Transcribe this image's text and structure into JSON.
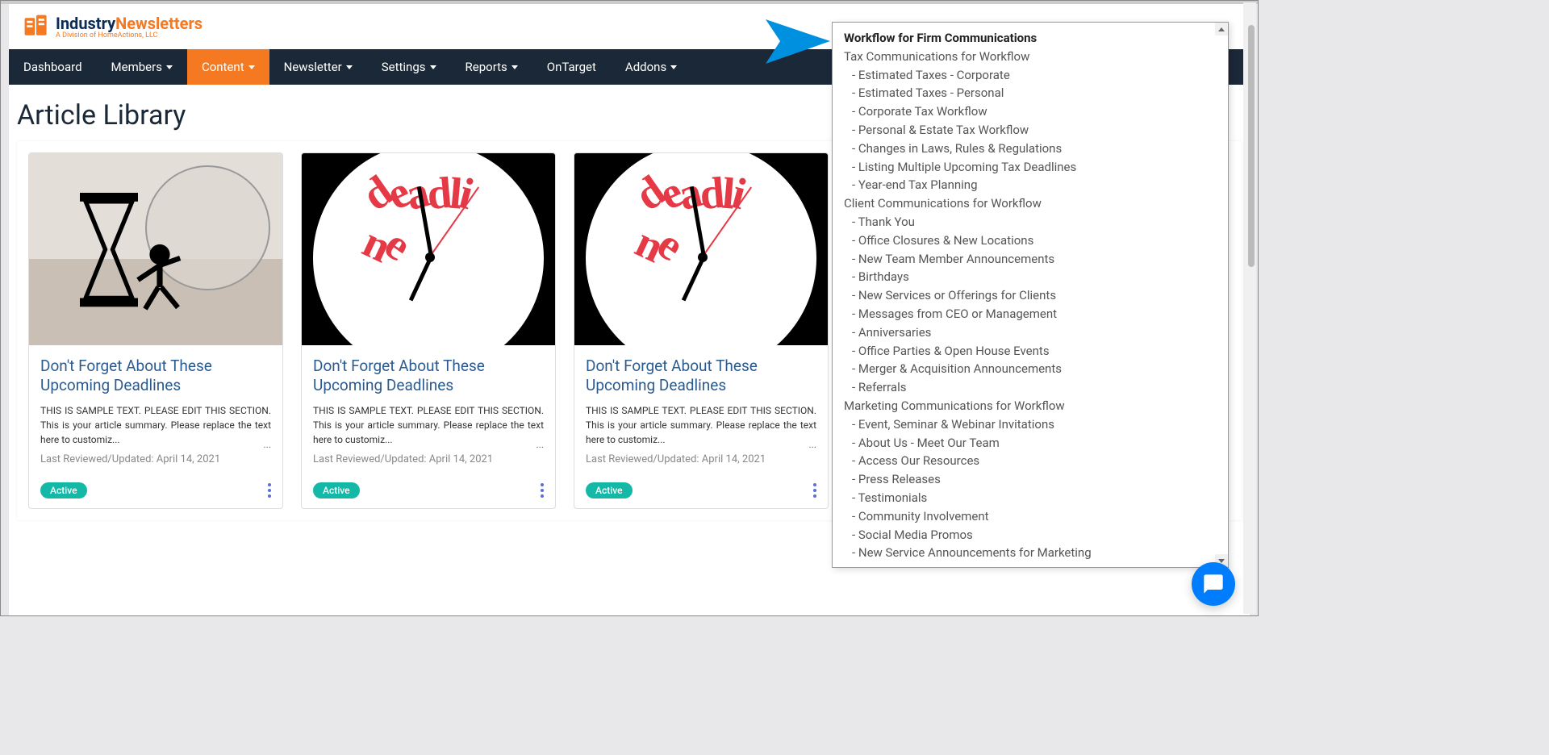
{
  "logo": {
    "brand1": "Industry",
    "brand2": "Newsletters",
    "subtitle": "A Division of HomeActions, LLC"
  },
  "nav": [
    {
      "label": "Dashboard",
      "dropdown": false,
      "active": false
    },
    {
      "label": "Members",
      "dropdown": true,
      "active": false
    },
    {
      "label": "Content",
      "dropdown": true,
      "active": true
    },
    {
      "label": "Newsletter",
      "dropdown": true,
      "active": false
    },
    {
      "label": "Settings",
      "dropdown": true,
      "active": false
    },
    {
      "label": "Reports",
      "dropdown": true,
      "active": false
    },
    {
      "label": "OnTarget",
      "dropdown": false,
      "active": false
    },
    {
      "label": "Addons",
      "dropdown": true,
      "active": false
    }
  ],
  "page": {
    "title": "Article Library"
  },
  "cards": [
    {
      "title": "Don't Forget About These Upcoming Deadlines",
      "summary": "THIS IS SAMPLE TEXT. PLEASE EDIT THIS SECTION. This is your article summary. Please replace the text here to customiz...",
      "date": "Last Reviewed/Updated: April 14, 2021",
      "badge": "Active",
      "imageType": "hourglass"
    },
    {
      "title": "Don't Forget About These Upcoming Deadlines",
      "summary": "THIS IS SAMPLE TEXT. PLEASE EDIT THIS SECTION. This is your article summary. Please replace the text here to customiz...",
      "date": "Last Reviewed/Updated: April 14, 2021",
      "badge": "Active",
      "imageType": "deadline"
    },
    {
      "title": "Don't Forget About These Upcoming Deadlines",
      "summary": "THIS IS SAMPLE TEXT. PLEASE EDIT THIS SECTION. This is your article summary. Please replace the text here to customiz...",
      "date": "Last Reviewed/Updated: April 14, 2021",
      "badge": "Active",
      "imageType": "deadline"
    }
  ],
  "dropdown": {
    "title": "Workflow for Firm Communications",
    "sections": [
      {
        "name": "Tax Communications for Workflow",
        "items": [
          "Estimated Taxes - Corporate",
          "Estimated Taxes - Personal",
          "Corporate Tax Workflow",
          "Personal & Estate Tax Workflow",
          "Changes in Laws, Rules & Regulations",
          "Listing Multiple Upcoming Tax Deadlines",
          "Year-end Tax Planning"
        ]
      },
      {
        "name": "Client Communications for Workflow",
        "items": [
          "Thank You",
          "Office Closures & New Locations",
          "New Team Member Announcements",
          "Birthdays",
          "New Services or Offerings for Clients",
          "Messages from CEO or Management",
          "Anniversaries",
          "Office Parties & Open House Events",
          "Merger & Acquisition Announcements",
          "Referrals"
        ]
      },
      {
        "name": "Marketing Communications for Workflow",
        "items": [
          "Event, Seminar & Webinar Invitations",
          "About Us - Meet Our Team",
          "Access Our Resources",
          "Press Releases",
          "Testimonials",
          "Community Involvement",
          "Social Media Promos",
          "New Service Announcements for Marketing"
        ]
      }
    ]
  },
  "deadlineText": "deadline"
}
